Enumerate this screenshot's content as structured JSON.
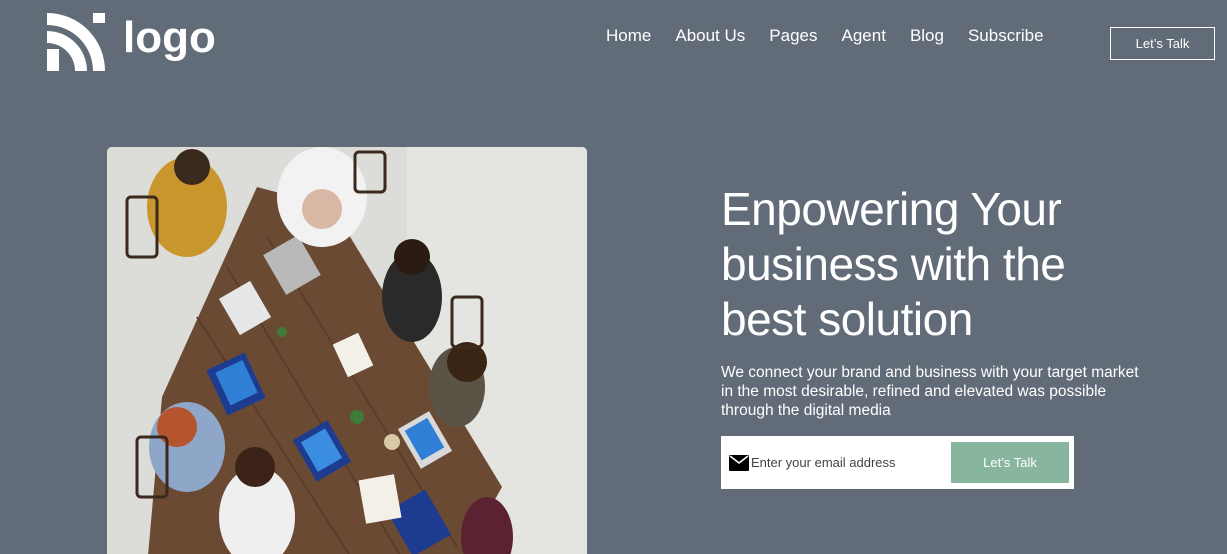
{
  "header": {
    "logo_text": "logo",
    "nav": [
      {
        "label": "Home"
      },
      {
        "label": "About Us"
      },
      {
        "label": "Pages"
      },
      {
        "label": "Agent"
      },
      {
        "label": "Blog"
      },
      {
        "label": "Subscribe"
      }
    ],
    "cta_label": "Let’s Talk"
  },
  "hero": {
    "title": "Enpowering Your business with the best solution",
    "description": "We connect your brand and business with your target market in the most desirable, refined and elevated was possible through the digital media",
    "email_placeholder": "Enter your email address",
    "email_value": "",
    "submit_label": "Let’s Talk",
    "image_icon": "team-meeting-photo",
    "mail_icon": "envelope-icon"
  },
  "colors": {
    "background": "#626b78",
    "accent": "#88b59e",
    "text": "#ffffff"
  }
}
